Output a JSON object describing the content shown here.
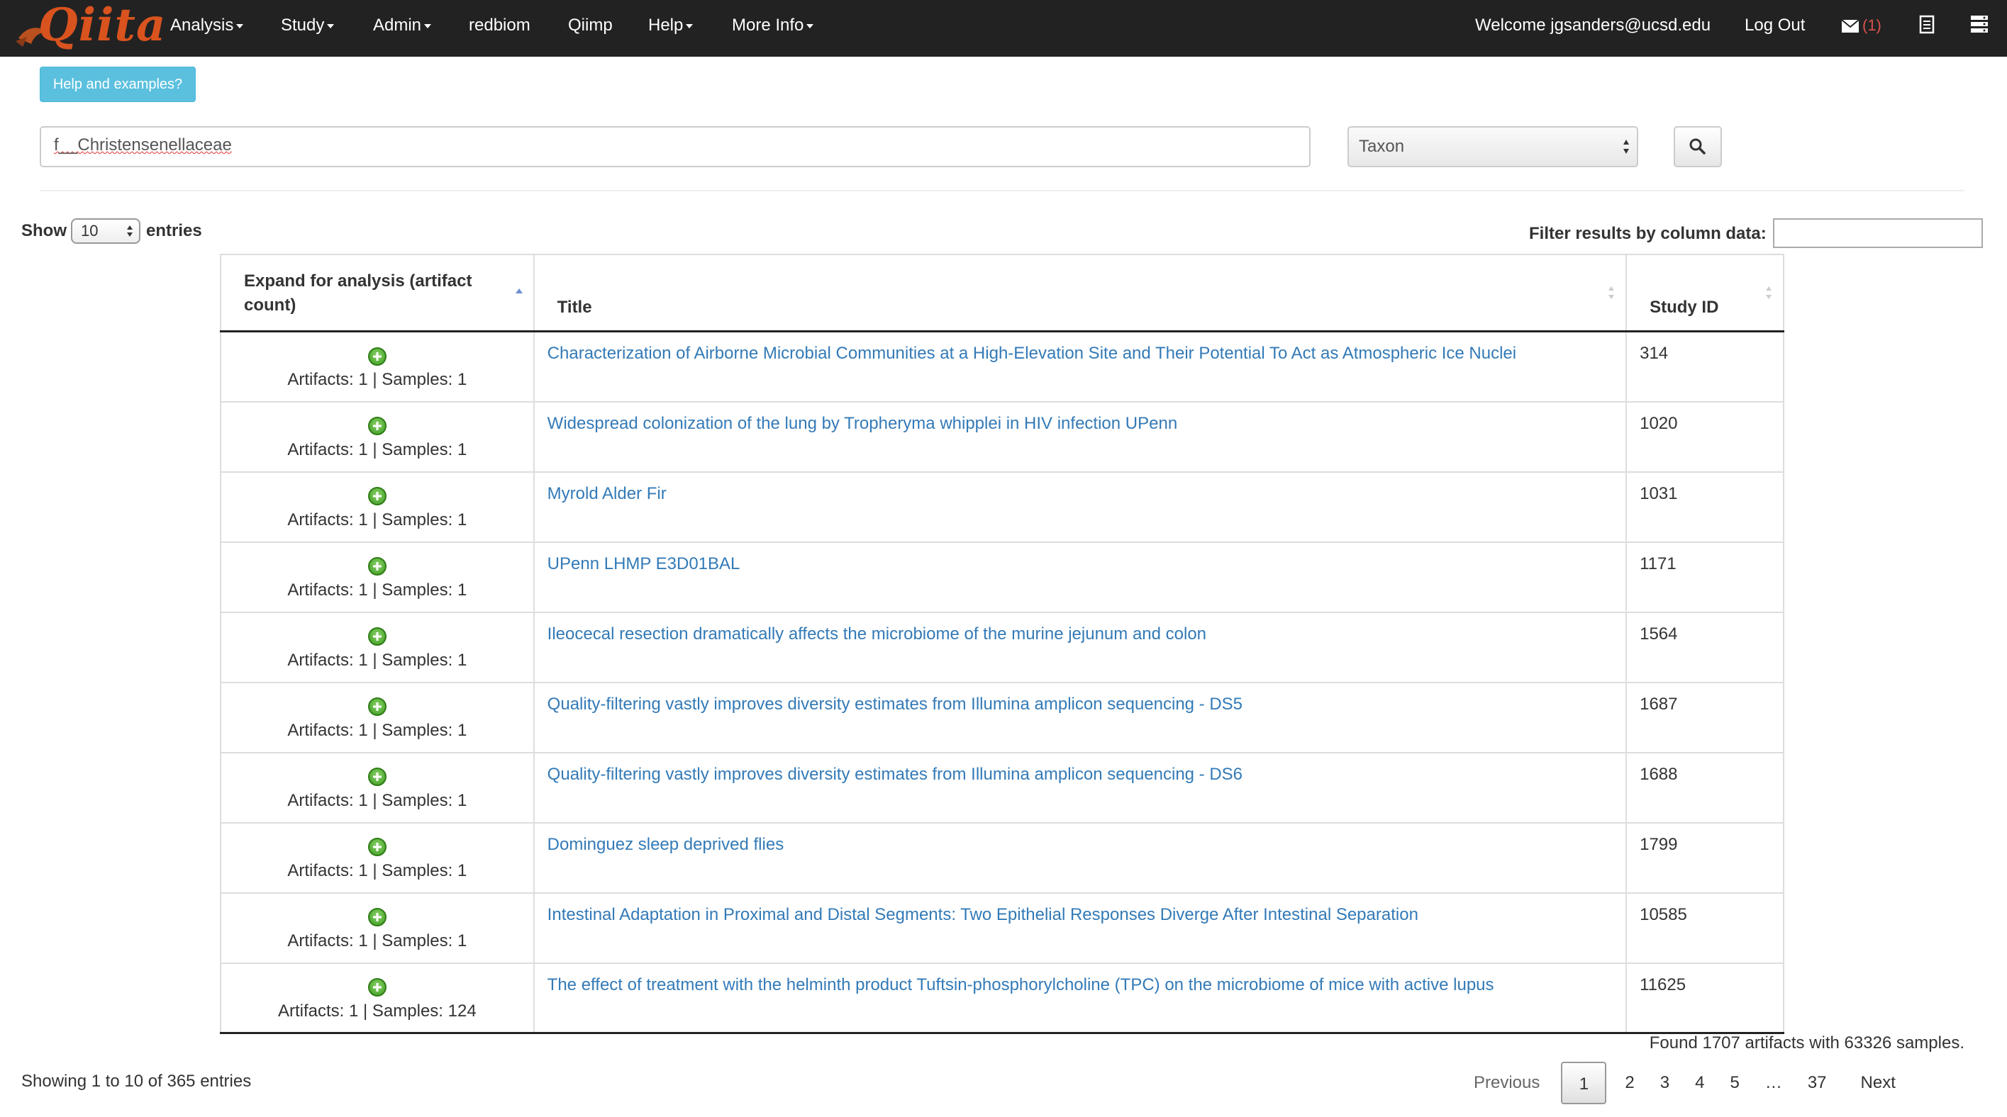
{
  "navbar": {
    "brand": "Qiita",
    "items": [
      {
        "label": "Analysis",
        "dropdown": true
      },
      {
        "label": "Study",
        "dropdown": true
      },
      {
        "label": "Admin",
        "dropdown": true
      },
      {
        "label": "redbiom",
        "dropdown": false
      },
      {
        "label": "Qiimp",
        "dropdown": false
      },
      {
        "label": "Help",
        "dropdown": true
      },
      {
        "label": "More Info",
        "dropdown": true
      }
    ],
    "welcome": "Welcome jgsanders@ucsd.edu",
    "logout": "Log Out",
    "messages_count": "(1)",
    "icons": [
      "envelope-icon",
      "clipboard-icon",
      "server-icon"
    ]
  },
  "help_button": "Help and examples?",
  "search": {
    "value": "f__Christensenellaceae",
    "type_selected": "Taxon"
  },
  "length": {
    "prefix": "Show",
    "value": "10",
    "suffix": "entries"
  },
  "filter_label": "Filter results by column data:",
  "table": {
    "headers": [
      "Expand for analysis (artifact count)",
      "Title",
      "Study ID"
    ],
    "rows": [
      {
        "counts": "Artifacts: 1 | Samples: 1",
        "title": "Characterization of Airborne Microbial Communities at a High-Elevation Site and Their Potential To Act as Atmospheric Ice Nuclei",
        "study_id": "314"
      },
      {
        "counts": "Artifacts: 1 | Samples: 1",
        "title": "Widespread colonization of the lung by Tropheryma whipplei in HIV infection UPenn",
        "study_id": "1020"
      },
      {
        "counts": "Artifacts: 1 | Samples: 1",
        "title": "Myrold Alder Fir",
        "study_id": "1031"
      },
      {
        "counts": "Artifacts: 1 | Samples: 1",
        "title": "UPenn LHMP E3D01BAL",
        "study_id": "1171"
      },
      {
        "counts": "Artifacts: 1 | Samples: 1",
        "title": "Ileocecal resection dramatically affects the microbiome of the murine jejunum and colon",
        "study_id": "1564"
      },
      {
        "counts": "Artifacts: 1 | Samples: 1",
        "title": "Quality-filtering vastly improves diversity estimates from Illumina amplicon sequencing - DS5",
        "study_id": "1687"
      },
      {
        "counts": "Artifacts: 1 | Samples: 1",
        "title": "Quality-filtering vastly improves diversity estimates from Illumina amplicon sequencing - DS6",
        "study_id": "1688"
      },
      {
        "counts": "Artifacts: 1 | Samples: 1",
        "title": "Dominguez sleep deprived flies",
        "study_id": "1799"
      },
      {
        "counts": "Artifacts: 1 | Samples: 1",
        "title": "Intestinal Adaptation in Proximal and Distal Segments: Two Epithelial Responses Diverge After Intestinal Separation",
        "study_id": "10585"
      },
      {
        "counts": "Artifacts: 1 | Samples: 124",
        "title": "The effect of treatment with the helminth product Tuftsin-phosphorylcholine (TPC) on the microbiome of mice with active lupus",
        "study_id": "11625"
      }
    ]
  },
  "found_summary": "Found 1707 artifacts with 63326 samples.",
  "info": "Showing 1 to 10 of 365 entries",
  "pagination": {
    "previous": "Previous",
    "pages": [
      "1",
      "2",
      "3",
      "4",
      "5",
      "…",
      "37"
    ],
    "current": "1",
    "next": "Next"
  },
  "colors": {
    "navbar_bg": "#222222",
    "brand": "#d9531e",
    "link": "#337ab7",
    "help_button": "#5bc0de",
    "message_count": "#d9534f",
    "expand_icon": "#3b9a1f"
  }
}
